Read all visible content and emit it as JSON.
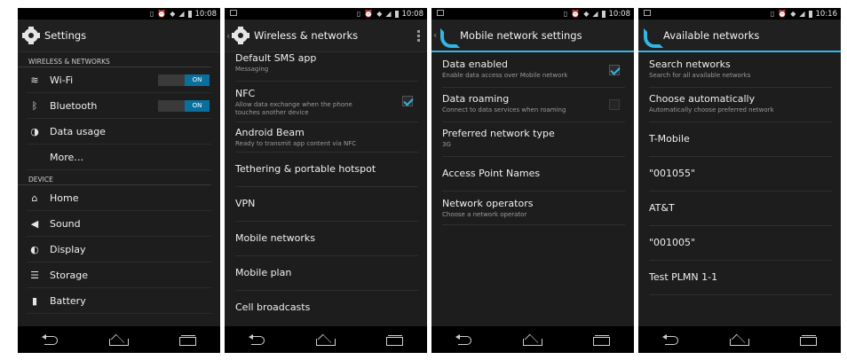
{
  "screens": [
    {
      "status_time": "10:08",
      "title": "Settings",
      "icon": "gear-icon",
      "sections": [
        {
          "header": "WIRELESS & NETWORKS",
          "items": [
            {
              "label": "Wi-Fi",
              "icon": "wifi-icon",
              "toggle": "ON"
            },
            {
              "label": "Bluetooth",
              "icon": "bluetooth-icon",
              "toggle": "ON"
            },
            {
              "label": "Data usage",
              "icon": "data-usage-icon"
            },
            {
              "label": "More…"
            }
          ]
        },
        {
          "header": "DEVICE",
          "items": [
            {
              "label": "Home",
              "icon": "home-icon"
            },
            {
              "label": "Sound",
              "icon": "sound-icon"
            },
            {
              "label": "Display",
              "icon": "display-icon"
            },
            {
              "label": "Storage",
              "icon": "storage-icon"
            },
            {
              "label": "Battery",
              "icon": "battery-icon"
            }
          ]
        }
      ]
    },
    {
      "status_time": "10:08",
      "title": "Wireless & networks",
      "icon": "gear-icon",
      "items": [
        {
          "title": "Default SMS app",
          "summary": "Messaging"
        },
        {
          "title": "NFC",
          "summary": "Allow data exchange when the phone touches another device",
          "checked": true
        },
        {
          "title": "Android Beam",
          "summary": "Ready to transmit app content via NFC"
        },
        {
          "title": "Tethering & portable hotspot"
        },
        {
          "title": "VPN"
        },
        {
          "title": "Mobile networks"
        },
        {
          "title": "Mobile plan"
        },
        {
          "title": "Cell broadcasts"
        }
      ]
    },
    {
      "status_time": "10:08",
      "title": "Mobile network settings",
      "icon": "phone-icon",
      "items": [
        {
          "title": "Data enabled",
          "summary": "Enable data access over Mobile network",
          "checked": true
        },
        {
          "title": "Data roaming",
          "summary": "Connect to data services when roaming",
          "checked": false
        },
        {
          "title": "Preferred network type",
          "summary": "3G"
        },
        {
          "title": "Access Point Names"
        },
        {
          "title": "Network operators",
          "summary": "Choose a network operator"
        }
      ]
    },
    {
      "status_time": "10:16",
      "title": "Available networks",
      "icon": "phone-icon",
      "items": [
        {
          "title": "Search networks",
          "summary": "Search for all available networks"
        },
        {
          "title": "Choose automatically",
          "summary": "Automatically choose preferred network"
        },
        {
          "title": "T-Mobile"
        },
        {
          "title": "\"001055\""
        },
        {
          "title": "AT&T"
        },
        {
          "title": "\"001005\""
        },
        {
          "title": "Test PLMN 1-1"
        }
      ]
    }
  ],
  "colors": {
    "accent": "#33b5e5",
    "toggle_on": "#0b6f9d",
    "background": "#1d1d1d"
  }
}
